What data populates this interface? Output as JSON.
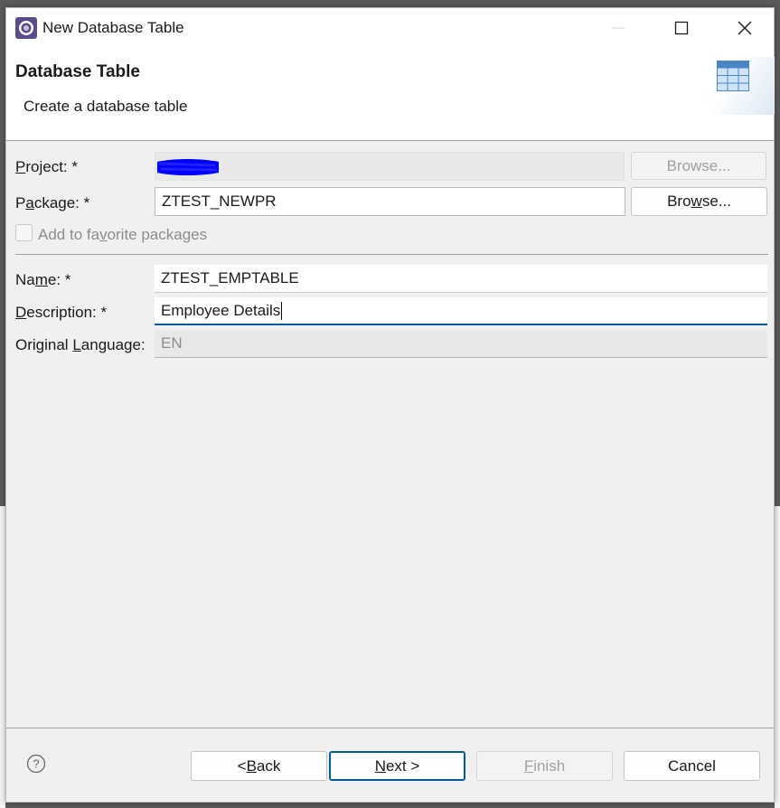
{
  "window": {
    "title": "New Database Table",
    "controls": {
      "minimize": "minimize-icon",
      "maximize": "maximize-icon",
      "close": "close-icon"
    }
  },
  "banner": {
    "title": "Database Table",
    "description": "Create a database table",
    "icon": "database-table-icon"
  },
  "form": {
    "project": {
      "label_pre": "",
      "label_u": "P",
      "label_post": "roject: *",
      "value": "",
      "browse_pre": "Browse...",
      "browse_u": "",
      "browse_post": ""
    },
    "package": {
      "label_pre": "P",
      "label_u": "a",
      "label_post": "ckage: *",
      "value": "ZTEST_NEWPR",
      "browse_pre": "Bro",
      "browse_u": "w",
      "browse_post": "se..."
    },
    "favorite": {
      "label_pre": "Add to fa",
      "label_u": "v",
      "label_post": "orite packages",
      "checked": false
    },
    "name": {
      "label_pre": "Na",
      "label_u": "m",
      "label_post": "e: *",
      "value": "ZTEST_EMPTABLE"
    },
    "description": {
      "label_pre": "",
      "label_u": "D",
      "label_post": "escription: *",
      "value": "Employee Details"
    },
    "language": {
      "label_pre": "Original ",
      "label_u": "L",
      "label_post": "anguage:",
      "value": "EN"
    }
  },
  "footer": {
    "help_icon": "help-icon",
    "back": {
      "pre": "< ",
      "u": "B",
      "post": "ack"
    },
    "next": {
      "pre": "",
      "u": "N",
      "post": "ext >"
    },
    "finish": {
      "pre": "",
      "u": "F",
      "post": "inish"
    },
    "cancel": {
      "pre": "Cancel",
      "u": "",
      "post": ""
    }
  },
  "colors": {
    "accent": "#005a9e",
    "redaction": "#0000ff"
  }
}
